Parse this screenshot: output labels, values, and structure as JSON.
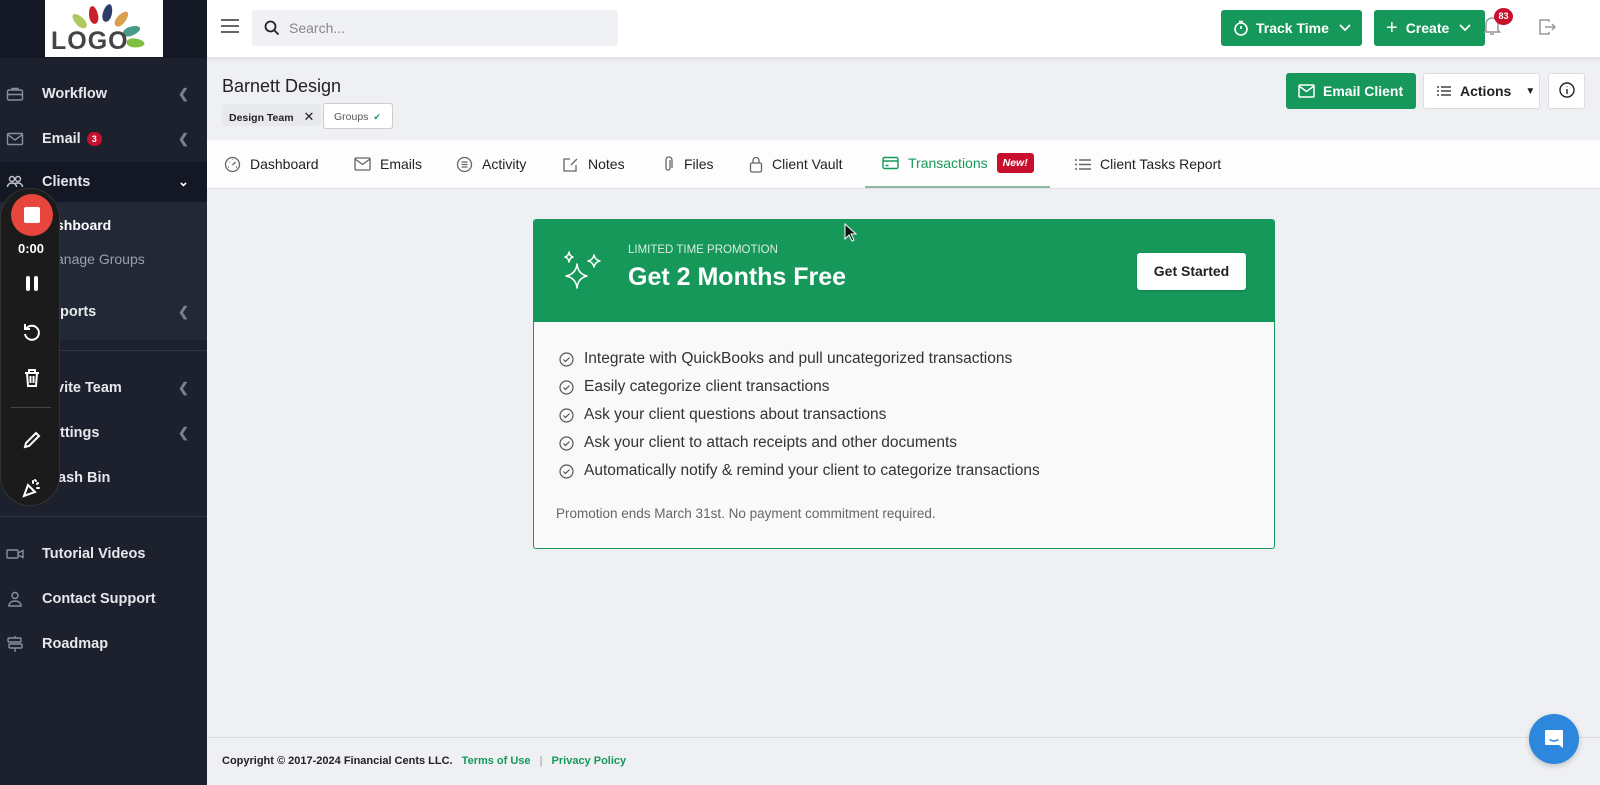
{
  "sidebar": {
    "logo_text": "LOGO",
    "items": [
      {
        "label": "Workflow",
        "icon": "briefcase-icon"
      },
      {
        "label": "Email",
        "icon": "envelope-icon",
        "badge": "3"
      },
      {
        "label": "Clients",
        "icon": "users-icon"
      },
      {
        "label": "shboard"
      },
      {
        "label": "anage Groups"
      },
      {
        "label": "ports"
      },
      {
        "label": "vite Team"
      },
      {
        "label": "ttings"
      },
      {
        "label": "ash Bin"
      },
      {
        "label": "Tutorial Videos",
        "icon": "video-icon"
      },
      {
        "label": "Contact Support",
        "icon": "user-icon"
      },
      {
        "label": "Roadmap",
        "icon": "signpost-icon"
      }
    ]
  },
  "recorder": {
    "time": "0:00"
  },
  "topbar": {
    "search_placeholder": "Search...",
    "track_time": "Track Time",
    "create": "Create",
    "notification_count": "83"
  },
  "client": {
    "name": "Barnett Design",
    "tag": "Design Team",
    "groups_label": "Groups",
    "email_client": "Email Client",
    "actions": "Actions"
  },
  "tabs": [
    {
      "label": "Dashboard"
    },
    {
      "label": "Emails"
    },
    {
      "label": "Activity"
    },
    {
      "label": "Notes"
    },
    {
      "label": "Files"
    },
    {
      "label": "Client Vault"
    },
    {
      "label": "Transactions",
      "badge": "New!",
      "active": true
    },
    {
      "label": "Client Tasks Report"
    }
  ],
  "promo": {
    "kicker": "LIMITED TIME PROMOTION",
    "title": "Get 2 Months Free",
    "cta": "Get Started",
    "features": [
      "Integrate with QuickBooks and pull uncategorized transactions",
      "Easily categorize client transactions",
      "Ask your client questions about transactions",
      "Ask your client to attach receipts and other documents",
      "Automatically notify & remind your client to categorize transactions"
    ],
    "note": "Promotion ends March 31st. No payment commitment required."
  },
  "footer": {
    "copyright": "Copyright © 2017-2024 Financial Cents LLC.",
    "terms": "Terms of Use",
    "separator": "|",
    "privacy": "Privacy Policy"
  },
  "colors": {
    "brand_green": "#16985a",
    "badge_red": "#c8102e",
    "sidebar_bg": "#1c212d",
    "chat_blue": "#2d87dd"
  }
}
